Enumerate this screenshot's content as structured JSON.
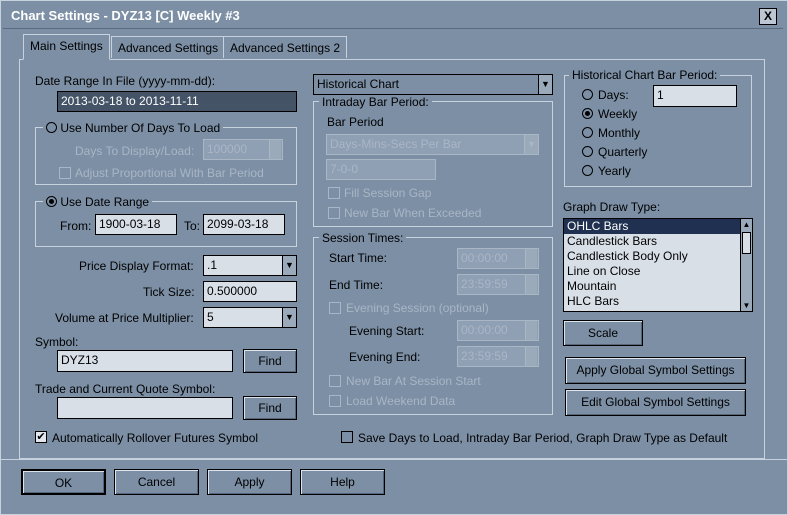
{
  "window": {
    "title": "Chart Settings - DYZ13 [C]  Weekly  #3",
    "close_label": "X"
  },
  "tabs": [
    {
      "label": "Main Settings",
      "active": true
    },
    {
      "label": "Advanced Settings",
      "active": false
    },
    {
      "label": "Advanced Settings 2",
      "active": false
    }
  ],
  "date_range": {
    "label": "Date Range In File (yyyy-mm-dd):",
    "value": "2013-03-18 to 2013-11-11"
  },
  "days_to_load": {
    "radio_label": "Use Number Of Days To Load",
    "days_label": "Days To Display/Load:",
    "days_value": "100000",
    "adjust_label": "Adjust Proportional With Bar Period"
  },
  "use_date_range": {
    "radio_label": "Use Date Range",
    "from_label": "From:",
    "from_value": "1900-03-18",
    "to_label": "To:",
    "to_value": "2099-03-18"
  },
  "price_display": {
    "label": "Price Display Format:",
    "value": ".1"
  },
  "tick_size": {
    "label": "Tick Size:",
    "value": "0.500000"
  },
  "volume_multiplier": {
    "label": "Volume at Price Multiplier:",
    "value": "5"
  },
  "symbol": {
    "label": "Symbol:",
    "value": "DYZ13",
    "find_label": "Find"
  },
  "trade_symbol": {
    "label": "Trade and Current Quote Symbol:",
    "value": "",
    "find_label": "Find"
  },
  "rollover": {
    "label": "Automatically Rollover Futures Symbol",
    "checked": true
  },
  "chart_type": {
    "value": "Historical Chart"
  },
  "intraday": {
    "group_label": "Intraday Bar Period:",
    "bar_period_label": "Bar Period",
    "bar_period_value": "Days-Mins-Secs Per Bar",
    "period_value": "7-0-0",
    "fill_gap_label": "Fill Session Gap",
    "new_bar_label": "New Bar When Exceeded"
  },
  "session": {
    "group_label": "Session Times:",
    "start_label": "Start Time:",
    "start_value": "00:00:00",
    "end_label": "End Time:",
    "end_value": "23:59:59",
    "evening_label": "Evening Session (optional)",
    "evening_start_label": "Evening Start:",
    "evening_start_value": "00:00:00",
    "evening_end_label": "Evening End:",
    "evening_end_value": "23:59:59",
    "new_bar_session_label": "New Bar At Session Start",
    "weekend_label": "Load Weekend Data"
  },
  "historical_period": {
    "group_label": "Historical Chart Bar Period:",
    "days_label": "Days:",
    "days_value": "1",
    "options": [
      "Weekly",
      "Monthly",
      "Quarterly",
      "Yearly"
    ],
    "selected": "Weekly"
  },
  "graph_draw": {
    "label": "Graph Draw Type:",
    "items": [
      "OHLC Bars",
      "Candlestick Bars",
      "Candlestick Body Only",
      "Line on Close",
      "Mountain",
      "HLC Bars"
    ],
    "selected": "OHLC Bars"
  },
  "scale_label": "Scale",
  "apply_global_label": "Apply Global Symbol Settings",
  "edit_global_label": "Edit Global Symbol Settings",
  "save_default": {
    "label": "Save Days to Load, Intraday Bar Period, Graph Draw Type as Default",
    "checked": false
  },
  "buttons": {
    "ok": "OK",
    "cancel": "Cancel",
    "apply": "Apply",
    "help": "Help"
  }
}
